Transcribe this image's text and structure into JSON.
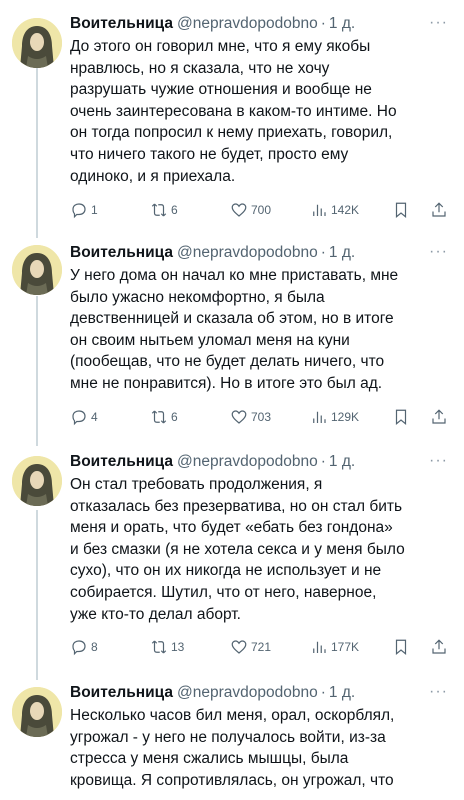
{
  "colors": {
    "text": "#0f1419",
    "secondary": "#536471",
    "background": "#ffffff"
  },
  "tweets": [
    {
      "author": "Воительница",
      "handle": "@nepravdopodobno",
      "time": "1 д.",
      "text": "До этого он говорил мне, что я ему якобы\nнравлюсь, но я сказала, что не хочу\nразрушать чужие отношения и вообще не\nочень заинтересована в каком-то интиме. Но\nон тогда попросил к нему приехать, говорил,\nчто ничего такого не будет, просто ему\nодиноко, и я приехала.",
      "replies": "1",
      "retweets": "6",
      "likes": "700",
      "views": "142K"
    },
    {
      "author": "Воительница",
      "handle": "@nepravdopodobno",
      "time": "1 д.",
      "text": "У него дома он начал ко мне приставать, мне\nбыло ужасно некомфортно, я была\nдевственницей и сказала об этом, но в итоге\nон своим нытьем уломал меня на куни\n(пообещав, что не будет делать ничего, что\nмне не понравится). Но в итоге это был ад.",
      "replies": "4",
      "retweets": "6",
      "likes": "703",
      "views": "129K"
    },
    {
      "author": "Воительница",
      "handle": "@nepravdopodobno",
      "time": "1 д.",
      "text": "Он  стал  требовать продолжения, я\nотказалась без презерватива, но он стал бить\nменя и орать, что будет «ебать без гондона»\nи без смазки (я не хотела секса и у меня было\nсухо), что он их никогда не использует и не\nсобирается. Шутил, что от него, наверное,\nуже кто-то делал аборт.",
      "replies": "8",
      "retweets": "13",
      "likes": "721",
      "views": "177K"
    },
    {
      "author": "Воительница",
      "handle": "@nepravdopodobno",
      "time": "1 д.",
      "text": "Несколько часов бил меня, орал, оскорблял,\nугрожал - у него не получалось войти, из-за\nстресса у меня сжались мышцы, была\nкровища. Я сопротивлялась, он угрожал, что"
    }
  ]
}
